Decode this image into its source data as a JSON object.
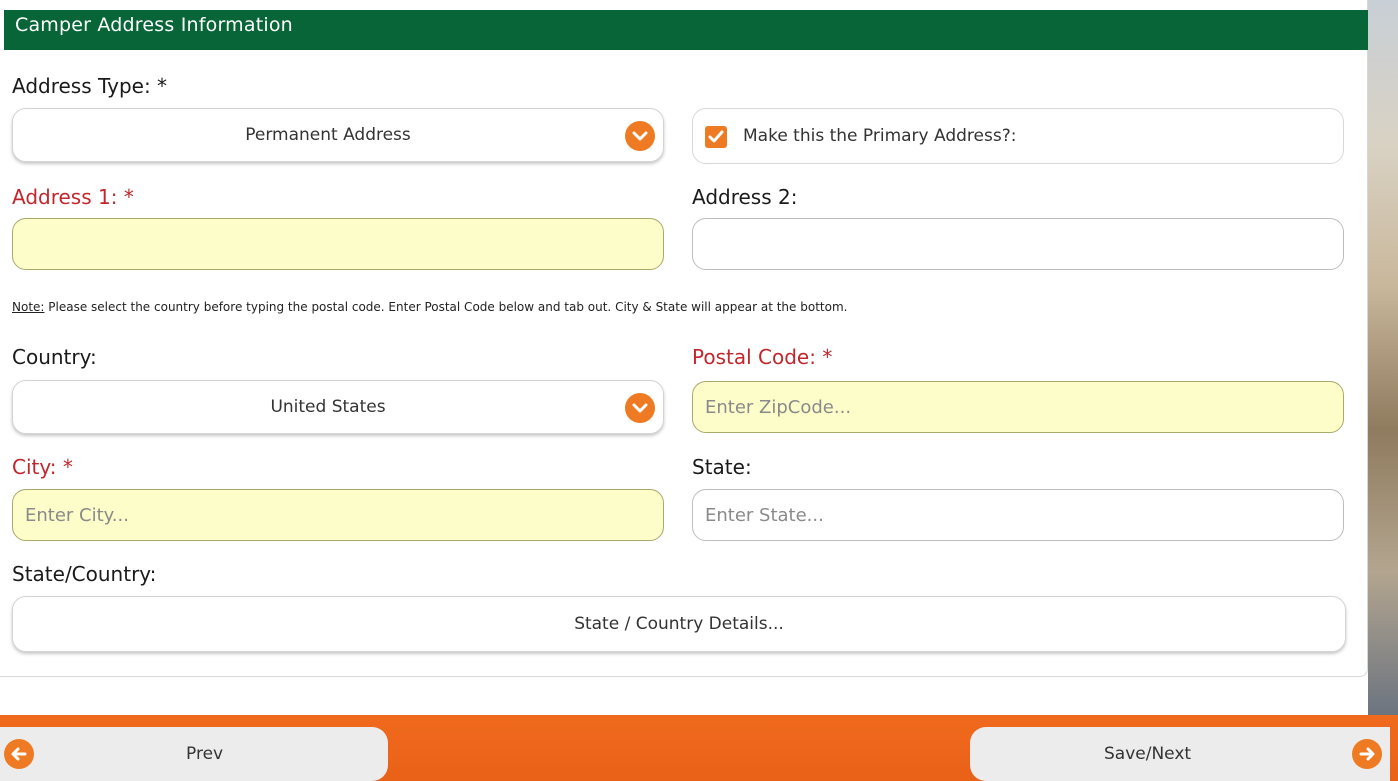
{
  "section": {
    "title": "Camper Address Information"
  },
  "address_type": {
    "label": "Address Type: *",
    "value": "Permanent Address"
  },
  "primary": {
    "label": "Make this the Primary Address?:",
    "checked": true
  },
  "address1": {
    "label": "Address 1: *",
    "value": ""
  },
  "address2": {
    "label": "Address 2:",
    "value": ""
  },
  "note": {
    "prefix": "Note:",
    "text": " Please select the country before typing the postal code. Enter Postal Code below and tab out. City & State will appear at the bottom."
  },
  "country": {
    "label": "Country:",
    "value": "United States"
  },
  "postal": {
    "label": "Postal Code: *",
    "placeholder": "Enter ZipCode..."
  },
  "city": {
    "label": "City: *",
    "placeholder": "Enter City..."
  },
  "state": {
    "label": "State:",
    "placeholder": "Enter State..."
  },
  "state_country": {
    "label": "State/Country:",
    "button": "State / Country Details..."
  },
  "footer": {
    "prev": "Prev",
    "next": "Save/Next"
  },
  "colors": {
    "header_green": "#086537",
    "accent_orange": "#ee7b24",
    "required_red": "#c0272d",
    "required_field_bg": "#fdfdc9"
  },
  "icons": {
    "dropdown": "chevron-down-icon",
    "checkbox": "check-icon",
    "prev": "arrow-left-icon",
    "next": "arrow-right-icon"
  }
}
